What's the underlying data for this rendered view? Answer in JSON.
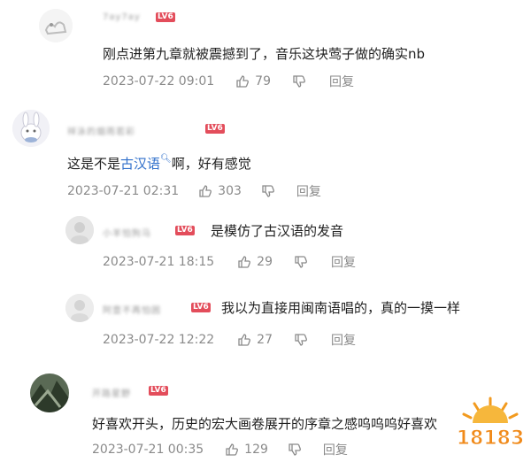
{
  "comments": [
    {
      "username": "7ay7ay",
      "level": "LV6",
      "text": "刚点进第九章就被震撼到了，音乐这块莺子做的确实nb",
      "time": "2023-07-22 09:01",
      "likes": "79",
      "reply_label": "回复"
    },
    {
      "username": "祥泳的烟雨若彩",
      "level": "LV6",
      "text_before": "这是不是",
      "text_link": "古汉语",
      "text_after": "啊，好有感觉",
      "time": "2023-07-21 02:31",
      "likes": "303",
      "reply_label": "回复"
    }
  ],
  "replies": [
    {
      "username": "小羊怕狗马",
      "level": "LV6",
      "text": "是模仿了古汉语的发音",
      "time": "2023-07-21 18:15",
      "likes": "29",
      "reply_label": "回复"
    },
    {
      "username": "阿壹不再怕困",
      "level": "LV6",
      "text": "我以为直接用闽南语唱的，真的一摸一样",
      "time": "2023-07-22 12:22",
      "likes": "27",
      "reply_label": "回复"
    }
  ],
  "comment3": {
    "username": "开路星野",
    "level": "LV6",
    "text": "好喜欢开头，历史的宏大画卷展开的序章之感呜呜呜好喜欢",
    "time": "2023-07-21 00:35",
    "likes": "129",
    "reply_label": "回复"
  },
  "watermark": {
    "text": "18183"
  },
  "colors": {
    "level_badge": "#e34d5b",
    "link": "#2f6fcb",
    "meta": "#8a8a8a"
  }
}
